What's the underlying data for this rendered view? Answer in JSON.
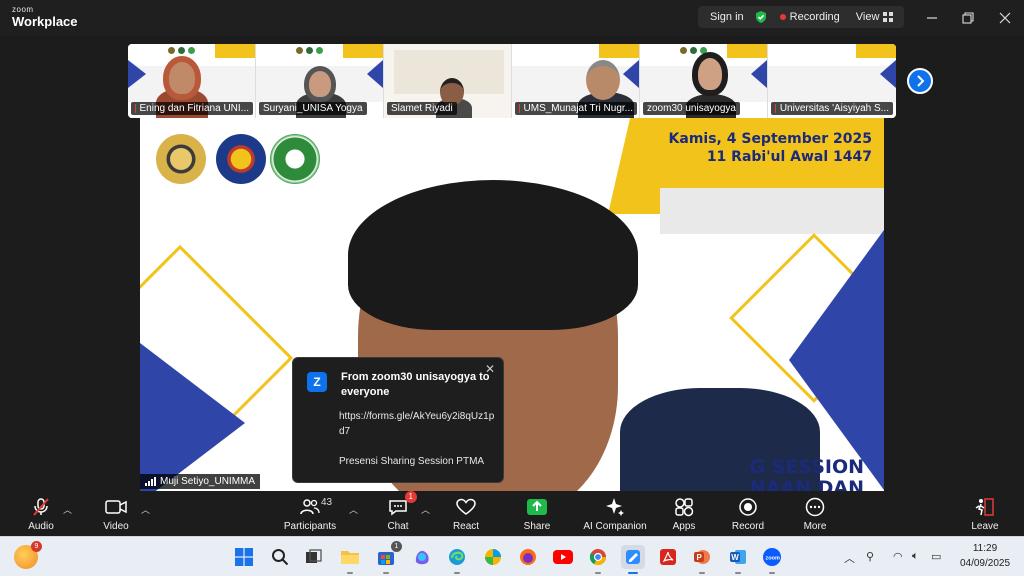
{
  "app": {
    "logo_top": "zoom",
    "logo_bottom": "Workplace"
  },
  "header": {
    "sign_in": "Sign in",
    "recording": "Recording",
    "view": "View"
  },
  "gallery": [
    {
      "name": "Ening dan Fitriana UNI...",
      "muted": true
    },
    {
      "name": "Suryani_UNISA Yogya",
      "muted": false
    },
    {
      "name": "Slamet Riyadi",
      "muted": false
    },
    {
      "name": "UMS_Munajat Tri Nugr...",
      "muted": true
    },
    {
      "name": "zoom30 unisayogya",
      "muted": false
    },
    {
      "name": "Universitas 'Aisyiyah S...",
      "muted": true
    }
  ],
  "main_video": {
    "date_line1": "Kamis, 4 September 2025",
    "date_line2": "11 Rabi'ul Awal 1447",
    "session_line1": "G SESSION",
    "session_line2": "NAAN DAN",
    "speaker_name": "Muji Setiyo_UNIMMA"
  },
  "chat_popup": {
    "avatar_letter": "Z",
    "from": "From zoom30 unisayogya to everyone",
    "link": "https://forms.gle/AkYeu6y2i8qUz1pd7",
    "message": "Presensi Sharing Session PTMA"
  },
  "toolbar": {
    "audio": "Audio",
    "video": "Video",
    "participants": "Participants",
    "participants_count": "43",
    "chat": "Chat",
    "chat_badge": "1",
    "react": "React",
    "share": "Share",
    "ai_companion": "AI Companion",
    "apps": "Apps",
    "record": "Record",
    "more": "More",
    "leave": "Leave"
  },
  "taskbar": {
    "weather_badge": "9",
    "store_badge": "1",
    "time": "11:29",
    "date": "04/09/2025"
  },
  "colors": {
    "zoom_blue": "#0e72ed",
    "slide_yellow": "#f2c31b",
    "slide_blue": "#2f45a8",
    "record_red": "#e53935"
  }
}
